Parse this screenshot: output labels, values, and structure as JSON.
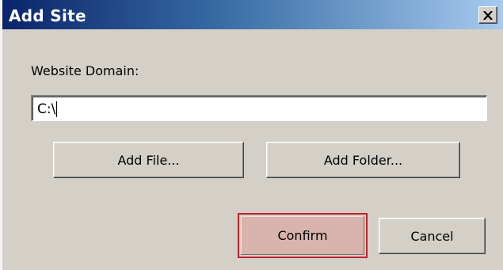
{
  "window": {
    "title": "Add Site",
    "close_glyph": "✕"
  },
  "form": {
    "domain_label": "Website Domain:",
    "domain_value": "C:\\"
  },
  "buttons": {
    "add_file": "Add File...",
    "add_folder": "Add Folder...",
    "confirm": "Confirm",
    "cancel": "Cancel"
  },
  "colors": {
    "title_gradient_start": "#0a246a",
    "title_gradient_end": "#a6caf0",
    "dialog_bg": "#d4d0c8",
    "confirm_highlight": "#c0202a",
    "confirm_fill": "#d8b4ac"
  },
  "icons": {
    "close": "close-icon"
  }
}
